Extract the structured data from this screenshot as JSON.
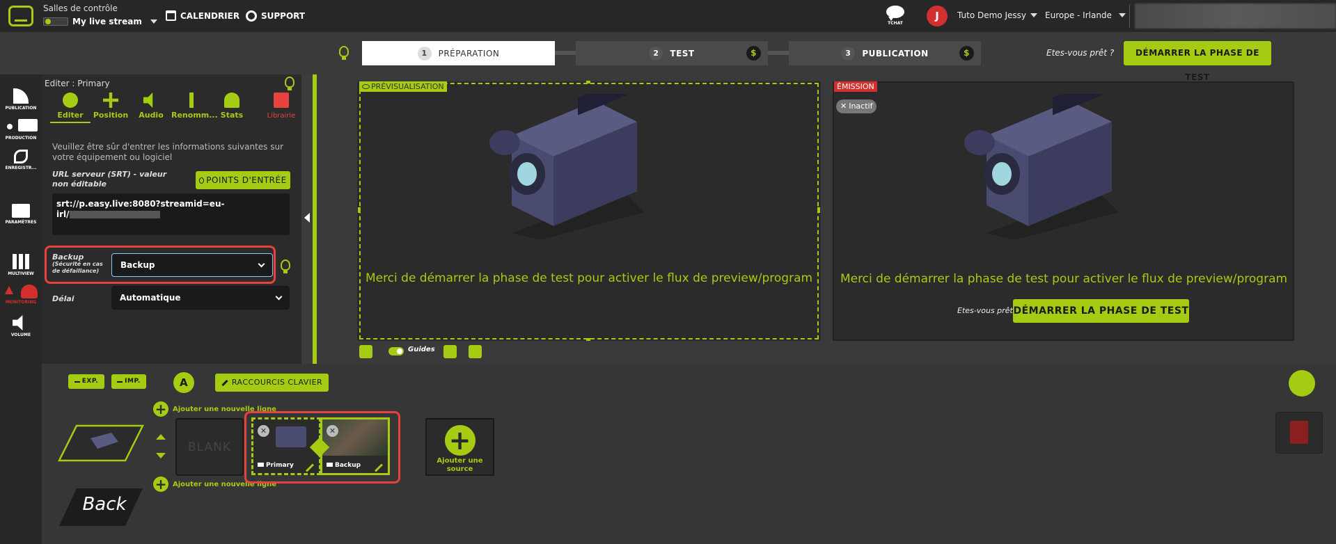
{
  "header": {
    "control_room": "Salles de contrôle",
    "stream_name": "My live stream",
    "calendar": "CALENDRIER",
    "support": "SUPPORT",
    "tchat": "TCHAT",
    "avatar_letter": "J",
    "user": "Tuto Demo Jessy",
    "region": "Europe - Irlande"
  },
  "steps": [
    {
      "num": "1",
      "label": "PRÉPARATION"
    },
    {
      "num": "2",
      "label": "TEST",
      "badge": "$"
    },
    {
      "num": "3",
      "label": "PUBLICATION",
      "badge": "$"
    }
  ],
  "ready_prompt": "Etes-vous prêt ?",
  "start_test_button": "DÉMARRER LA PHASE DE TEST",
  "leftbar": [
    "PUBLICATION",
    "PRODUCTION",
    "ENREGISTR...",
    "PARAMÈTRES",
    "MULTIVIEW",
    "MONITORING",
    "VOLUME"
  ],
  "editor": {
    "title": "Editer : Primary",
    "tabs": [
      "Editer",
      "Position",
      "Audio",
      "Renomm...",
      "Stats"
    ],
    "library": "Librairie",
    "help": "Veuillez être sûr d'entrer les informations suivantes sur votre équipement ou logiciel",
    "url_label": "URL serveur (SRT) - valeur non éditable",
    "entry_points": "POINTS D'ENTRÉE",
    "url_line1": "srt://p.easy.live:8080?streamid=eu-",
    "url_line2": "irl/",
    "backup_label": "Backup",
    "backup_sub": "(Sécurité en cas de défaillance)",
    "backup_value": "Backup",
    "delai_label": "Délai",
    "delai_value": "Automatique"
  },
  "preview": {
    "tag": "PRÉVISUALISATION",
    "message": "Merci de démarrer la phase de test pour activer le flux de preview/program",
    "guides": "Guides"
  },
  "emission": {
    "tag": "ÉMISSION",
    "status": "Inactif",
    "message": "Merci de démarrer la phase de test pour activer le flux de preview/program",
    "ready_prompt": "Etes-vous prêt",
    "button": "DÉMARRER LA PHASE DE TEST"
  },
  "bottom": {
    "exp": "EXP.",
    "imp": "IMP.",
    "a_label": "A",
    "shortcuts": "RACCOURCIS CLAVIER",
    "add_line": "Ajouter une nouvelle ligne",
    "blank": "BLANK",
    "sources": [
      {
        "label": "Primary"
      },
      {
        "label": "Backup"
      }
    ],
    "add_source": "Ajouter une source",
    "back": "Back"
  }
}
